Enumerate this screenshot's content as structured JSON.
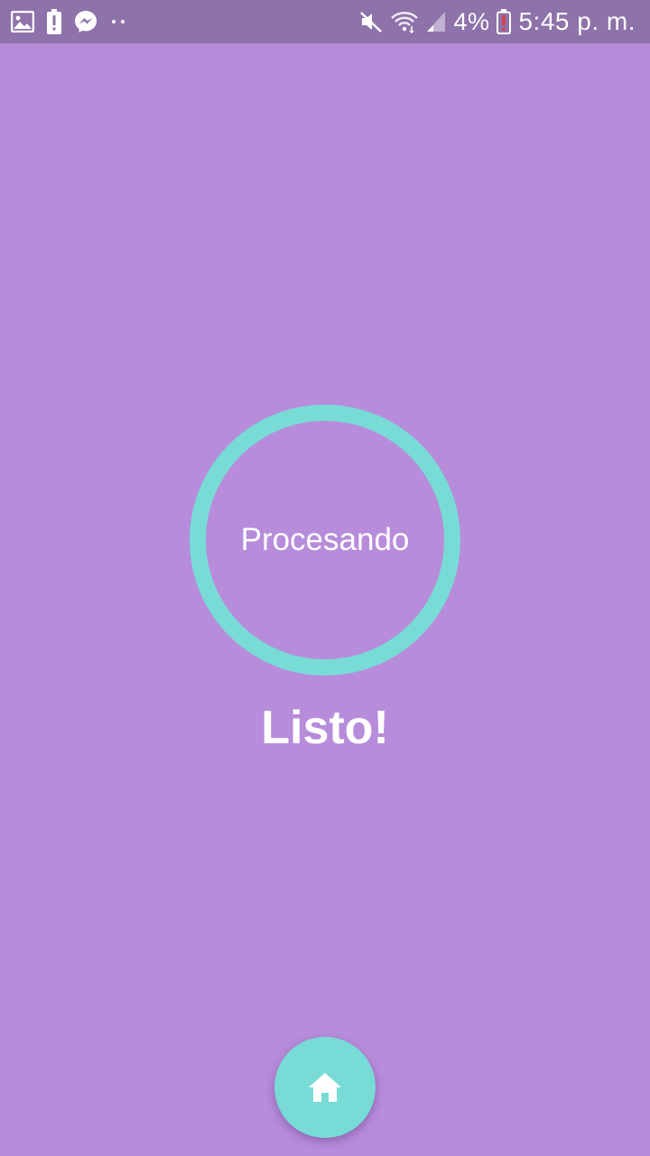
{
  "status_bar": {
    "battery_percent": "4%",
    "time": "5:45 p. m.",
    "notification_icons": [
      "image-icon",
      "battery-alert-icon",
      "messenger-icon",
      "more-dots-icon"
    ],
    "system_icons": [
      "mute-icon",
      "wifi-icon",
      "signal-icon",
      "battery-low-icon"
    ]
  },
  "main": {
    "progress_label": "Procesando",
    "done_title": "Listo!"
  },
  "fab": {
    "icon": "home-icon"
  },
  "colors": {
    "background": "#b78cdb",
    "status_bar": "#8e72aa",
    "accent": "#78dbd6",
    "text": "#ffffff"
  }
}
